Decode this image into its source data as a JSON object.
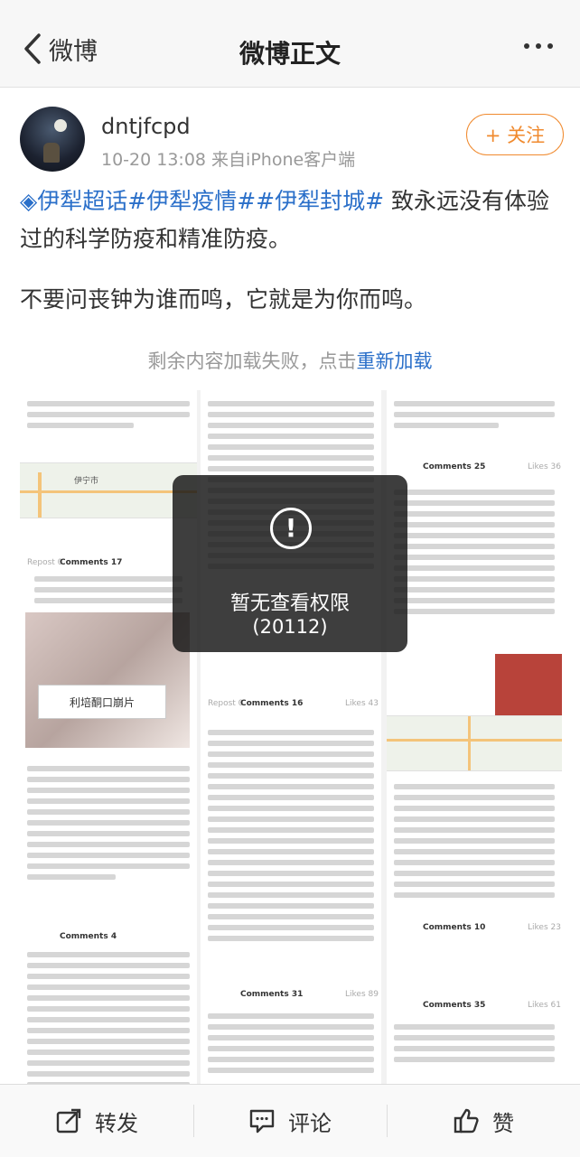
{
  "nav": {
    "back_label": "微博",
    "title": "微博正文"
  },
  "author": {
    "username": "dntjfcpd",
    "meta": "10-20 13:08  来自iPhone客户端",
    "follow_label": "+ 关注"
  },
  "post": {
    "topic1": "伊犁超话",
    "topic2": "#伊犁疫情#",
    "topic3": "#伊犁封城#",
    "text_a": " 致永远没有体验过的科学防疫和精准防疫。",
    "text_b": "不要问丧钟为谁而鸣，它就是为你而鸣。"
  },
  "reload": {
    "prefix": "剩余内容加载失败，点击",
    "link": "重新加载"
  },
  "toast": {
    "message": "暂无查看权限",
    "code": "(20112)"
  },
  "collage": {
    "map_label": "伊宁市",
    "box_label": "利培酮口崩片",
    "col1_repost": "Repost 0",
    "col1_comments": "Comments 17",
    "col1_comments2": "Comments 4",
    "col2_repost": "Repost 0",
    "col2_comments": "Comments 16",
    "col2_likes": "Likes 43",
    "col2_comments2": "Comments 31",
    "col2_likes2": "Likes 89",
    "col3_comments": "Comments 25",
    "col3_likes": "Likes 36",
    "col3_comments2": "Comments 10",
    "col3_likes2": "Likes 23",
    "col3_comments3": "Comments 35",
    "col3_likes3": "Likes 61"
  },
  "tabbar": {
    "repost": "转发",
    "comment": "评论",
    "like": "赞"
  },
  "colors": {
    "accent": "#f08a2e",
    "link": "#2a6fc9"
  },
  "icons": [
    "back-chevron-icon",
    "more-dots-icon",
    "warning-icon",
    "repost-icon",
    "comment-icon",
    "thumbs-up-icon"
  ]
}
